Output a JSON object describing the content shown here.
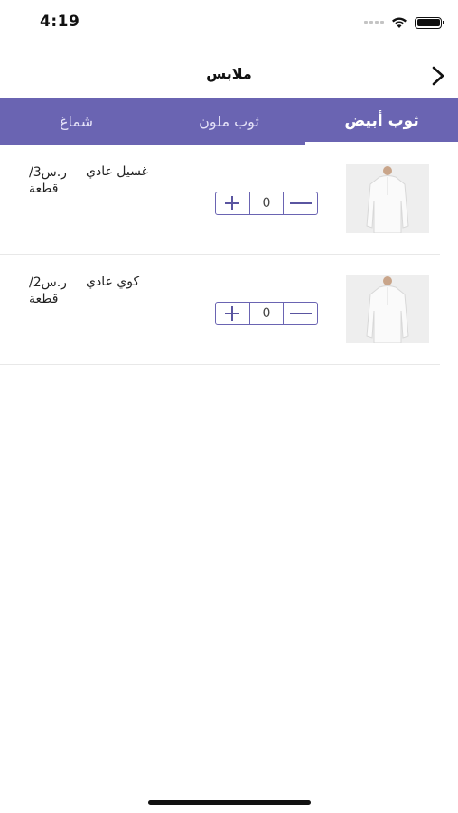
{
  "status_bar": {
    "time": "4:19"
  },
  "nav": {
    "title": "ملابس",
    "back_icon": "chevron-right-icon"
  },
  "tabs": [
    {
      "label": "ثوب أبيض",
      "active": true
    },
    {
      "label": "ثوب ملون",
      "active": false
    },
    {
      "label": "شماغ",
      "active": false
    }
  ],
  "items": [
    {
      "name": "غسيل عادي",
      "price_line1": "ر.س3/",
      "price_line2": "قطعة",
      "quantity": "0",
      "image_icon": "white-thobe-image"
    },
    {
      "name": "كوي عادي",
      "price_line1": "ر.س2/",
      "price_line2": "قطعة",
      "quantity": "0",
      "image_icon": "white-thobe-image"
    }
  ],
  "colors": {
    "accent": "#6a64b2",
    "tab_text": "#e4e1f7"
  }
}
